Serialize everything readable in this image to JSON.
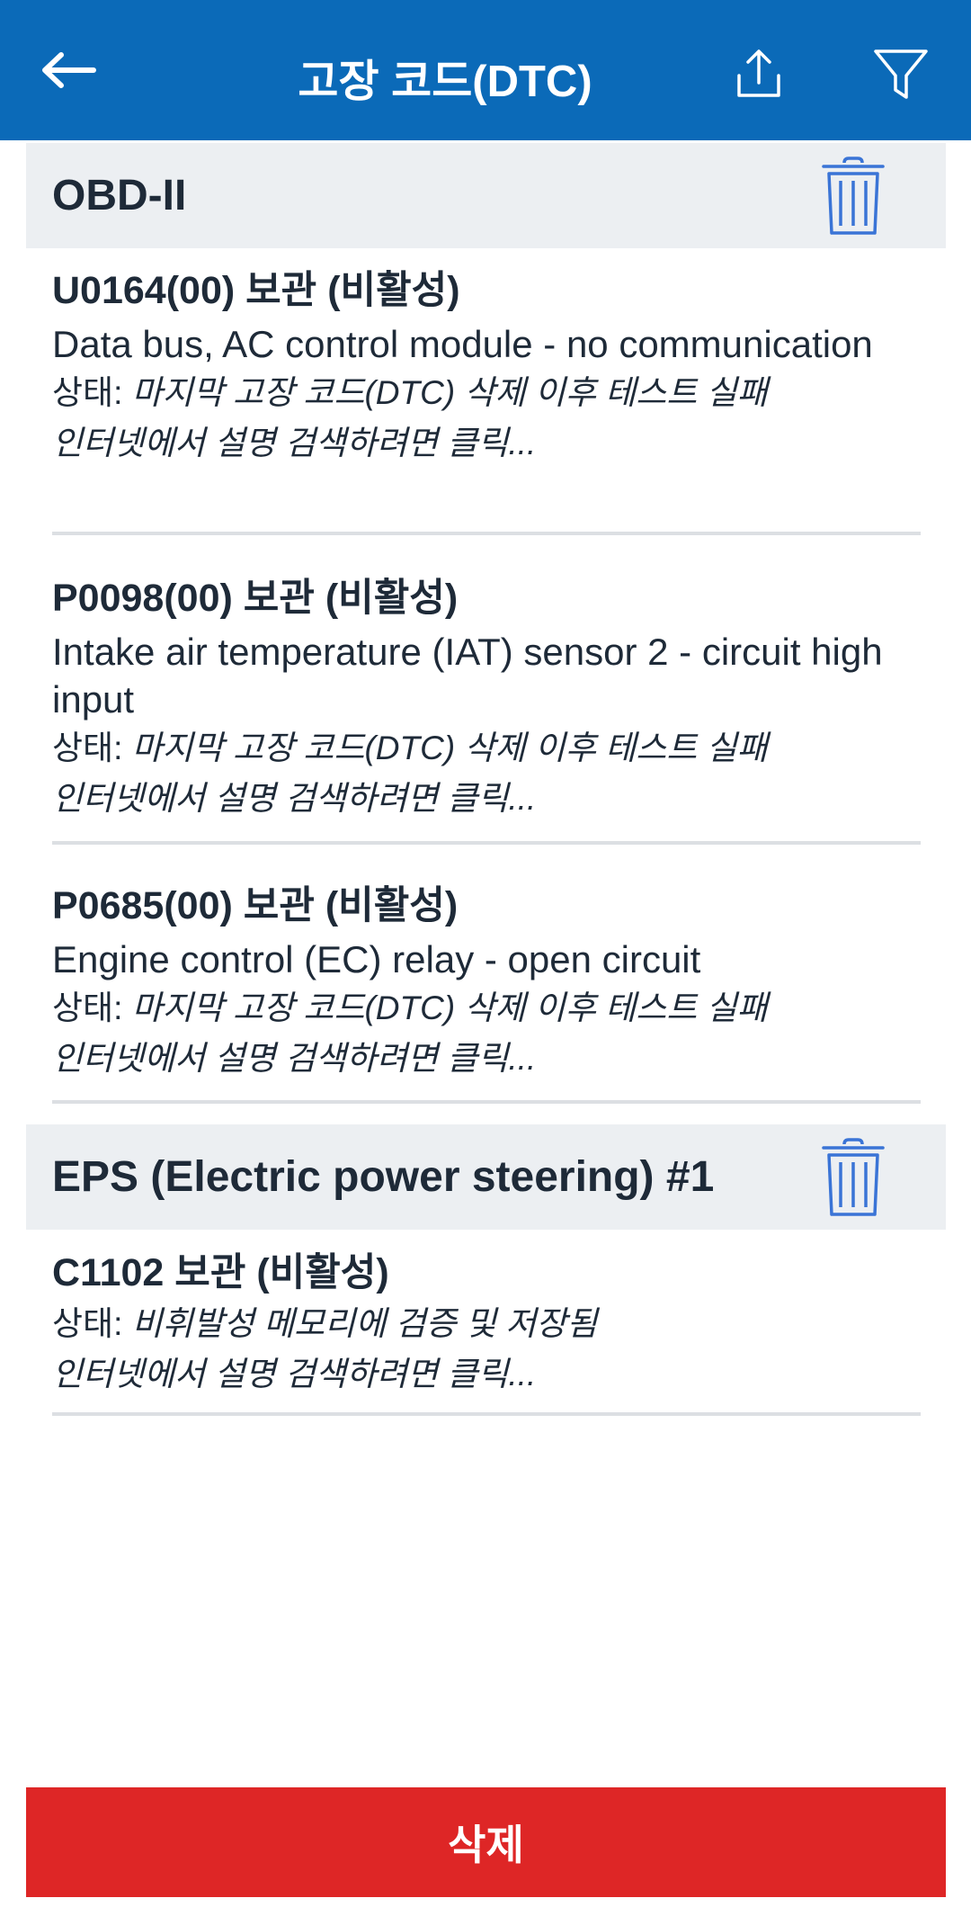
{
  "appbar": {
    "title": "고장 코드(DTC)",
    "back_icon": "arrow-left-icon",
    "share_icon": "share-icon",
    "filter_icon": "filter-icon",
    "background": "#0b6ab8"
  },
  "status_label": "상태: ",
  "link_text": "인터넷에서 설명 검색하려면 클릭...",
  "sections": [
    {
      "title": "OBD-II",
      "delete_icon": "trash-icon",
      "items": [
        {
          "code": "U0164(00) 보관 (비활성)",
          "description": "Data bus, AC control module - no communication",
          "status": "마지막 고장 코드(DTC) 삭제 이후 테스트 실패"
        },
        {
          "code": "P0098(00) 보관 (비활성)",
          "description": "Intake air temperature (IAT) sensor 2 - circuit high input",
          "status": "마지막 고장 코드(DTC) 삭제 이후 테스트 실패"
        },
        {
          "code": "P0685(00) 보관 (비활성)",
          "description": "Engine control (EC) relay - open circuit",
          "status": "마지막 고장 코드(DTC) 삭제 이후 테스트 실패"
        }
      ]
    },
    {
      "title": "EPS (Electric power steering) #1",
      "delete_icon": "trash-icon",
      "items": [
        {
          "code": "C1102 보관 (비활성)",
          "status": "비휘발성 메모리에 검증 및 저장됨"
        }
      ]
    }
  ],
  "delete_button": {
    "label": "삭제",
    "color": "#de2626"
  }
}
